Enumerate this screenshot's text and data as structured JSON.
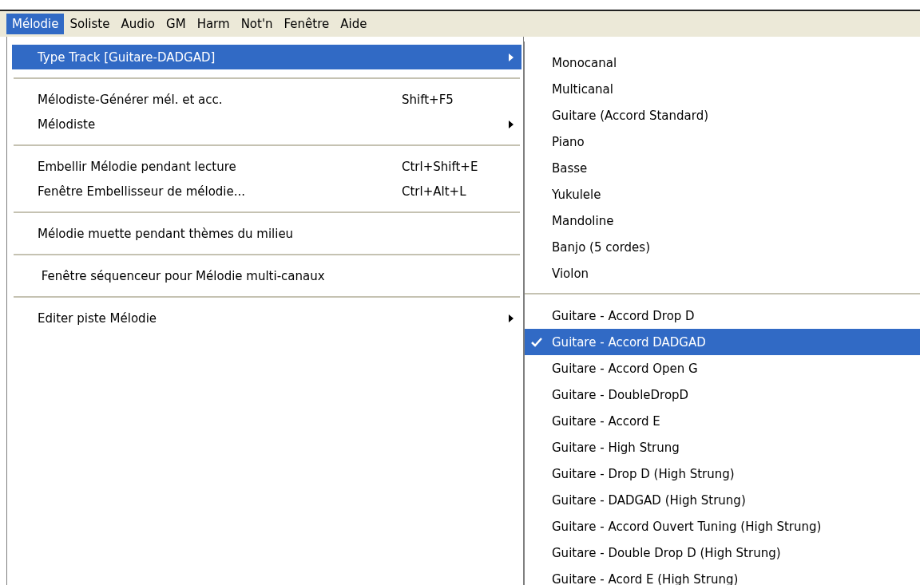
{
  "menubar": {
    "items": [
      {
        "label": "Mélodie",
        "selected": true
      },
      {
        "label": "Soliste",
        "selected": false
      },
      {
        "label": "Audio",
        "selected": false
      },
      {
        "label": "GM",
        "selected": false
      },
      {
        "label": "Harm",
        "selected": false
      },
      {
        "label": "Not'n",
        "selected": false
      },
      {
        "label": "Fenêtre",
        "selected": false
      },
      {
        "label": "Aide",
        "selected": false
      }
    ]
  },
  "menu": {
    "items": [
      {
        "kind": "item",
        "label": "Type Track [Guitare-DADGAD]",
        "selected": true,
        "submenu": true
      },
      {
        "kind": "separator"
      },
      {
        "kind": "item",
        "label": "Mélodiste-Générer mél. et acc.",
        "shortcut": "Shift+F5",
        "selected": false,
        "submenu": false
      },
      {
        "kind": "item",
        "label": "Mélodiste",
        "selected": false,
        "submenu": true
      },
      {
        "kind": "separator"
      },
      {
        "kind": "item",
        "label": "Embellir Mélodie pendant lecture",
        "shortcut": "Ctrl+Shift+E",
        "selected": false,
        "submenu": false
      },
      {
        "kind": "item",
        "label": "Fenêtre Embellisseur de mélodie...",
        "shortcut": "Ctrl+Alt+L",
        "selected": false,
        "submenu": false
      },
      {
        "kind": "separator"
      },
      {
        "kind": "item",
        "label": "Mélodie muette pendant thèmes du milieu",
        "selected": false,
        "submenu": false
      },
      {
        "kind": "separator"
      },
      {
        "kind": "item",
        "label": " Fenêtre séquenceur pour Mélodie multi-canaux",
        "selected": false,
        "submenu": false
      },
      {
        "kind": "separator"
      },
      {
        "kind": "item",
        "label": "Editer piste Mélodie",
        "selected": false,
        "submenu": true
      }
    ]
  },
  "submenu": {
    "items": [
      {
        "kind": "item",
        "label": "Monocanal",
        "selected": false,
        "checked": false
      },
      {
        "kind": "item",
        "label": "Multicanal",
        "selected": false,
        "checked": false
      },
      {
        "kind": "item",
        "label": "Guitare (Accord Standard)",
        "selected": false,
        "checked": false
      },
      {
        "kind": "item",
        "label": "Piano",
        "selected": false,
        "checked": false
      },
      {
        "kind": "item",
        "label": "Basse",
        "selected": false,
        "checked": false
      },
      {
        "kind": "item",
        "label": "Yukulele",
        "selected": false,
        "checked": false
      },
      {
        "kind": "item",
        "label": "Mandoline",
        "selected": false,
        "checked": false
      },
      {
        "kind": "item",
        "label": "Banjo (5 cordes)",
        "selected": false,
        "checked": false
      },
      {
        "kind": "item",
        "label": "Violon",
        "selected": false,
        "checked": false
      },
      {
        "kind": "separator"
      },
      {
        "kind": "item",
        "label": "Guitare - Accord Drop D",
        "selected": false,
        "checked": false
      },
      {
        "kind": "item",
        "label": "Guitare - Accord DADGAD",
        "selected": true,
        "checked": true
      },
      {
        "kind": "item",
        "label": "Guitare - Accord Open G",
        "selected": false,
        "checked": false
      },
      {
        "kind": "item",
        "label": "Guitare - DoubleDropD",
        "selected": false,
        "checked": false
      },
      {
        "kind": "item",
        "label": "Guitare - Accord E",
        "selected": false,
        "checked": false
      },
      {
        "kind": "item",
        "label": "Guitare - High Strung",
        "selected": false,
        "checked": false
      },
      {
        "kind": "item",
        "label": "Guitare - Drop D (High Strung)",
        "selected": false,
        "checked": false
      },
      {
        "kind": "item",
        "label": "Guitare - DADGAD (High Strung)",
        "selected": false,
        "checked": false
      },
      {
        "kind": "item",
        "label": "Guitare - Accord Ouvert Tuning (High Strung)",
        "selected": false,
        "checked": false
      },
      {
        "kind": "item",
        "label": "Guitare - Double Drop D (High Strung)",
        "selected": false,
        "checked": false
      },
      {
        "kind": "item",
        "label": "Guitare - Acord E (High Strung)",
        "selected": false,
        "checked": false
      }
    ]
  }
}
